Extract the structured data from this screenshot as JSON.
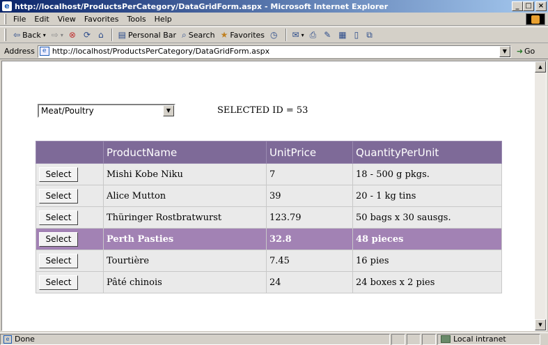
{
  "window": {
    "title": "http://localhost/ProductsPerCategory/DataGridForm.aspx - Microsoft Internet Explorer",
    "minimize": "_",
    "maximize": "□",
    "close": "×"
  },
  "menu": [
    "File",
    "Edit",
    "View",
    "Favorites",
    "Tools",
    "Help"
  ],
  "toolbar": {
    "back": "Back",
    "personal_bar": "Personal Bar",
    "search": "Search",
    "favorites": "Favorites"
  },
  "address": {
    "label": "Address",
    "url": "http://localhost/ProductsPerCategory/DataGridForm.aspx",
    "go": "Go"
  },
  "page": {
    "category_selected": "Meat/Poultry",
    "selected_id_text": "SELECTED ID = 53",
    "grid": {
      "columns": [
        "",
        "ProductName",
        "UnitPrice",
        "QuantityPerUnit"
      ],
      "select_label": "Select",
      "selected_row_index": 3,
      "rows": [
        {
          "name": "Mishi Kobe Niku",
          "price": "7",
          "qty": "18 - 500 g pkgs."
        },
        {
          "name": "Alice Mutton",
          "price": "39",
          "qty": "20 - 1 kg tins"
        },
        {
          "name": "Thüringer Rostbratwurst",
          "price": "123.79",
          "qty": "50 bags x 30 sausgs."
        },
        {
          "name": "Perth Pasties",
          "price": "32.8",
          "qty": "48 pieces"
        },
        {
          "name": "Tourtière",
          "price": "7.45",
          "qty": "16 pies"
        },
        {
          "name": "Pâté chinois",
          "price": "24",
          "qty": "24 boxes x 2 pies"
        }
      ]
    }
  },
  "status": {
    "text": "Done",
    "zone": "Local intranet"
  },
  "colors": {
    "header_bg": "#7e6a98",
    "selected_row_bg": "#a282b4",
    "row_bg": "#eaeaea"
  }
}
